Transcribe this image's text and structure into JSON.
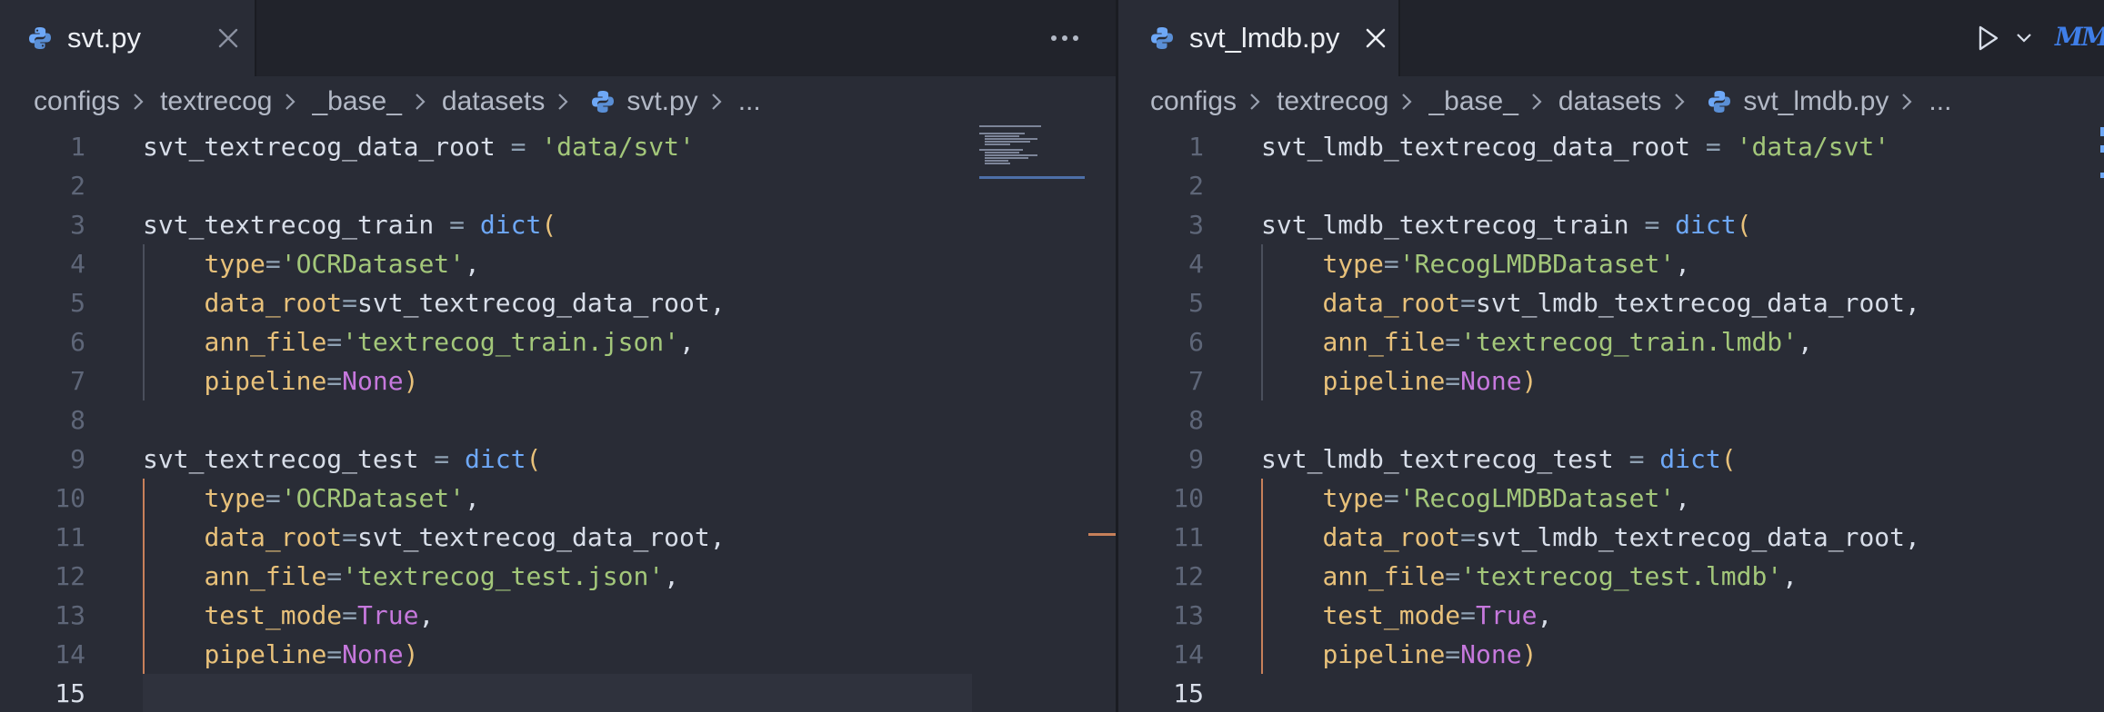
{
  "left": {
    "tab": {
      "filename": "svt.py",
      "icon": "python-icon"
    },
    "more_label": "more-actions",
    "breadcrumb": [
      "configs",
      "textrecog",
      "_base_",
      "datasets",
      "svt.py",
      "..."
    ],
    "lines": [
      {
        "n": "1",
        "tokens": [
          [
            "k",
            "svt_textrecog_data_root "
          ],
          [
            "op",
            "= "
          ],
          [
            "str",
            "'data/svt'"
          ]
        ]
      },
      {
        "n": "2",
        "tokens": []
      },
      {
        "n": "3",
        "tokens": [
          [
            "k",
            "svt_textrecog_train "
          ],
          [
            "op",
            "= "
          ],
          [
            "fn",
            "dict"
          ],
          [
            "param",
            "("
          ]
        ]
      },
      {
        "n": "4",
        "tokens": [
          [
            "k",
            "    "
          ],
          [
            "param",
            "type"
          ],
          [
            "op",
            "="
          ],
          [
            "str",
            "'OCRDataset'"
          ],
          [
            "k",
            ","
          ]
        ]
      },
      {
        "n": "5",
        "tokens": [
          [
            "k",
            "    "
          ],
          [
            "param",
            "data_root"
          ],
          [
            "op",
            "="
          ],
          [
            "k",
            "svt_textrecog_data_root,"
          ]
        ]
      },
      {
        "n": "6",
        "tokens": [
          [
            "k",
            "    "
          ],
          [
            "param",
            "ann_file"
          ],
          [
            "op",
            "="
          ],
          [
            "str",
            "'textrecog_train.json'"
          ],
          [
            "k",
            ","
          ]
        ]
      },
      {
        "n": "7",
        "tokens": [
          [
            "k",
            "    "
          ],
          [
            "param",
            "pipeline"
          ],
          [
            "op",
            "="
          ],
          [
            "const",
            "None"
          ],
          [
            "param",
            ")"
          ]
        ]
      },
      {
        "n": "8",
        "tokens": []
      },
      {
        "n": "9",
        "tokens": [
          [
            "k",
            "svt_textrecog_test "
          ],
          [
            "op",
            "= "
          ],
          [
            "fn",
            "dict"
          ],
          [
            "param",
            "("
          ]
        ]
      },
      {
        "n": "10",
        "tokens": [
          [
            "k",
            "    "
          ],
          [
            "param",
            "type"
          ],
          [
            "op",
            "="
          ],
          [
            "str",
            "'OCRDataset'"
          ],
          [
            "k",
            ","
          ]
        ]
      },
      {
        "n": "11",
        "tokens": [
          [
            "k",
            "    "
          ],
          [
            "param",
            "data_root"
          ],
          [
            "op",
            "="
          ],
          [
            "k",
            "svt_textrecog_data_root,"
          ]
        ]
      },
      {
        "n": "12",
        "tokens": [
          [
            "k",
            "    "
          ],
          [
            "param",
            "ann_file"
          ],
          [
            "op",
            "="
          ],
          [
            "str",
            "'textrecog_test.json'"
          ],
          [
            "k",
            ","
          ]
        ]
      },
      {
        "n": "13",
        "tokens": [
          [
            "k",
            "    "
          ],
          [
            "param",
            "test_mode"
          ],
          [
            "op",
            "="
          ],
          [
            "const",
            "True"
          ],
          [
            "k",
            ","
          ]
        ]
      },
      {
        "n": "14",
        "tokens": [
          [
            "k",
            "    "
          ],
          [
            "param",
            "pipeline"
          ],
          [
            "op",
            "="
          ],
          [
            "const",
            "None"
          ],
          [
            "param",
            ")"
          ]
        ]
      },
      {
        "n": "15",
        "tokens": []
      }
    ]
  },
  "right": {
    "tab": {
      "filename": "svt_lmdb.py",
      "icon": "python-icon"
    },
    "breadcrumb": [
      "configs",
      "textrecog",
      "_base_",
      "datasets",
      "svt_lmdb.py",
      "..."
    ],
    "lines": [
      {
        "n": "1",
        "tokens": [
          [
            "k",
            "svt_lmdb_textrecog_data_root "
          ],
          [
            "op",
            "= "
          ],
          [
            "str",
            "'data/svt'"
          ]
        ]
      },
      {
        "n": "2",
        "tokens": []
      },
      {
        "n": "3",
        "tokens": [
          [
            "k",
            "svt_lmdb_textrecog_train "
          ],
          [
            "op",
            "= "
          ],
          [
            "fn",
            "dict"
          ],
          [
            "param",
            "("
          ]
        ]
      },
      {
        "n": "4",
        "tokens": [
          [
            "k",
            "    "
          ],
          [
            "param",
            "type"
          ],
          [
            "op",
            "="
          ],
          [
            "str",
            "'RecogLMDBDataset'"
          ],
          [
            "k",
            ","
          ]
        ]
      },
      {
        "n": "5",
        "tokens": [
          [
            "k",
            "    "
          ],
          [
            "param",
            "data_root"
          ],
          [
            "op",
            "="
          ],
          [
            "k",
            "svt_lmdb_textrecog_data_root,"
          ]
        ]
      },
      {
        "n": "6",
        "tokens": [
          [
            "k",
            "    "
          ],
          [
            "param",
            "ann_file"
          ],
          [
            "op",
            "="
          ],
          [
            "str",
            "'textrecog_train.lmdb'"
          ],
          [
            "k",
            ","
          ]
        ]
      },
      {
        "n": "7",
        "tokens": [
          [
            "k",
            "    "
          ],
          [
            "param",
            "pipeline"
          ],
          [
            "op",
            "="
          ],
          [
            "const",
            "None"
          ],
          [
            "param",
            ")"
          ]
        ]
      },
      {
        "n": "8",
        "tokens": []
      },
      {
        "n": "9",
        "tokens": [
          [
            "k",
            "svt_lmdb_textrecog_test "
          ],
          [
            "op",
            "= "
          ],
          [
            "fn",
            "dict"
          ],
          [
            "param",
            "("
          ]
        ]
      },
      {
        "n": "10",
        "tokens": [
          [
            "k",
            "    "
          ],
          [
            "param",
            "type"
          ],
          [
            "op",
            "="
          ],
          [
            "str",
            "'RecogLMDBDataset'"
          ],
          [
            "k",
            ","
          ]
        ]
      },
      {
        "n": "11",
        "tokens": [
          [
            "k",
            "    "
          ],
          [
            "param",
            "data_root"
          ],
          [
            "op",
            "="
          ],
          [
            "k",
            "svt_lmdb_textrecog_data_root,"
          ]
        ]
      },
      {
        "n": "12",
        "tokens": [
          [
            "k",
            "    "
          ],
          [
            "param",
            "ann_file"
          ],
          [
            "op",
            "="
          ],
          [
            "str",
            "'textrecog_test.lmdb'"
          ],
          [
            "k",
            ","
          ]
        ]
      },
      {
        "n": "13",
        "tokens": [
          [
            "k",
            "    "
          ],
          [
            "param",
            "test_mode"
          ],
          [
            "op",
            "="
          ],
          [
            "const",
            "True"
          ],
          [
            "k",
            ","
          ]
        ]
      },
      {
        "n": "14",
        "tokens": [
          [
            "k",
            "    "
          ],
          [
            "param",
            "pipeline"
          ],
          [
            "op",
            "="
          ],
          [
            "const",
            "None"
          ],
          [
            "param",
            ")"
          ]
        ]
      },
      {
        "n": "15",
        "tokens": []
      }
    ]
  },
  "current_line": "15",
  "toolbar": {
    "run_icon": "play-icon",
    "split_icon": "chevron-down-icon",
    "extension_label": "MM"
  },
  "colors": {
    "accent": "#3f7ee8",
    "string": "#a3c77a",
    "param": "#e8c17a",
    "const": "#c678dd",
    "func": "#6ea8f7",
    "modified": "#c7805a"
  }
}
